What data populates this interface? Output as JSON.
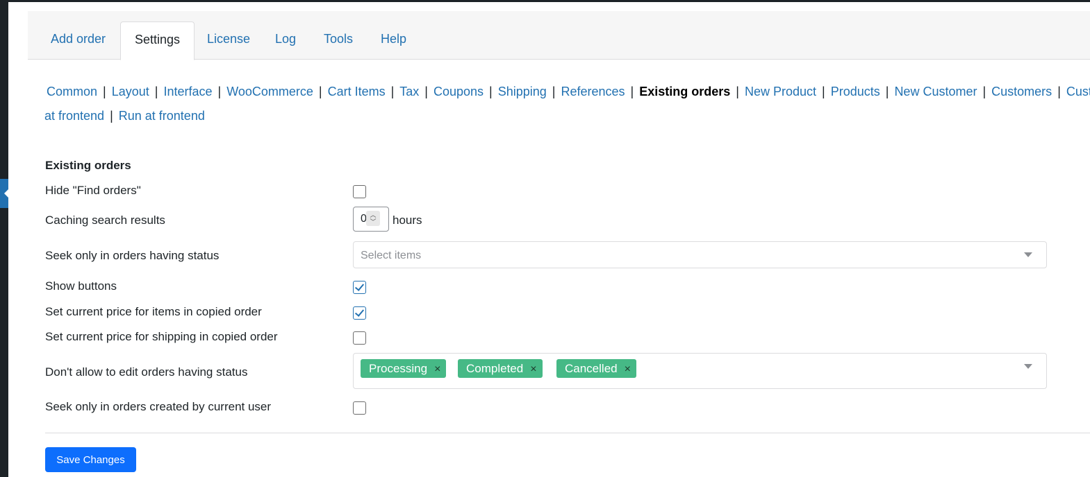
{
  "tabs": [
    {
      "label": "Add order"
    },
    {
      "label": "Settings"
    },
    {
      "label": "License"
    },
    {
      "label": "Log"
    },
    {
      "label": "Tools"
    },
    {
      "label": "Help"
    }
  ],
  "subnav": {
    "items": [
      "Common",
      "Layout",
      "Interface",
      "WooCommerce",
      "Cart Items",
      "Tax",
      "Coupons",
      "Shipping",
      "References",
      "Existing orders",
      "New Product",
      "Products",
      "New Customer",
      "Customers",
      "Custom fiel"
    ],
    "line2": [
      "at frontend",
      "Run at frontend"
    ],
    "separator": "|"
  },
  "section": {
    "title": "Existing orders"
  },
  "settings": {
    "hide_find_orders": {
      "label": "Hide \"Find orders\"",
      "checked": false
    },
    "caching": {
      "label": "Caching search results",
      "value": "0",
      "unit": "hours"
    },
    "seek_status": {
      "label": "Seek only in orders having status",
      "placeholder": "Select items"
    },
    "show_buttons": {
      "label": "Show buttons",
      "checked": true
    },
    "current_price_items": {
      "label": "Set current price for items in copied order",
      "checked": true
    },
    "current_price_shipping": {
      "label": "Set current price for shipping in copied order",
      "checked": false
    },
    "no_edit_status": {
      "label": "Don't allow to edit orders having status",
      "tags": [
        "Processing",
        "Completed",
        "Cancelled"
      ],
      "remove_glyph": "×"
    },
    "seek_current_user": {
      "label": "Seek only in orders created by current user",
      "checked": false
    }
  },
  "save_label": "Save Changes",
  "colors": {
    "accent": "#2271b1",
    "tag": "#46b986",
    "button": "#0d6efd"
  }
}
